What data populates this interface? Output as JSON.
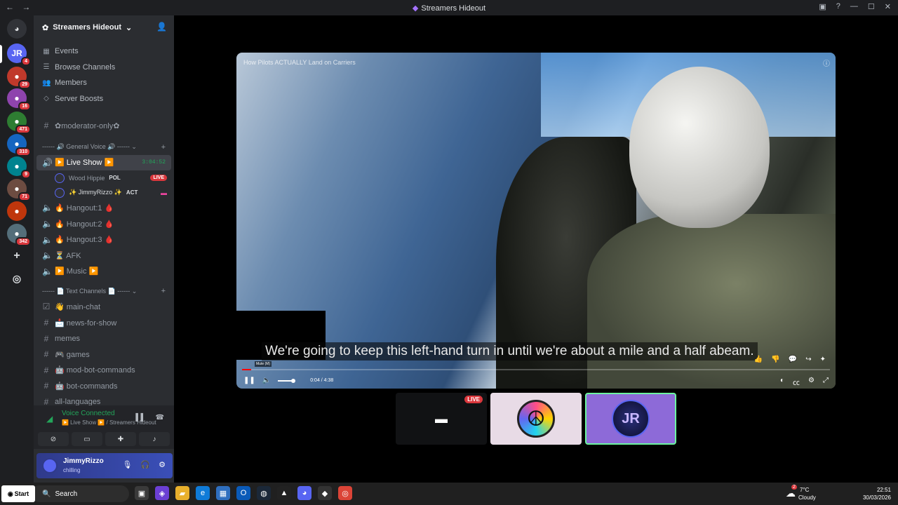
{
  "window": {
    "title": "Streamers Hideout"
  },
  "server": {
    "name": "Streamers Hideout"
  },
  "rail": {
    "badges": [
      "4",
      "29",
      "16",
      "471",
      "310",
      "9",
      "71",
      "342"
    ]
  },
  "menu": [
    {
      "label": "Events"
    },
    {
      "label": "Browse Channels"
    },
    {
      "label": "Members"
    },
    {
      "label": "Server Boosts"
    }
  ],
  "channels_top": [
    {
      "label": "✿moderator-only✿"
    }
  ],
  "voice_category": "------ 🔊 General Voice 🔊 ------",
  "voice_channels": [
    {
      "label": "▶️ Live Show ▶️",
      "timer": "3:04:52"
    },
    {
      "label": "🔥 Hangout:1 🩸"
    },
    {
      "label": "🔥 Hangout:2 🩸"
    },
    {
      "label": "🔥 Hangout:3 🩸"
    },
    {
      "label": "⏳ AFK"
    },
    {
      "label": "▶️ Music ▶️"
    }
  ],
  "voice_users": [
    {
      "name": "Wood Hippie",
      "tag": "POL",
      "status": "LIVE"
    },
    {
      "name": "✨ JimmyRizzo ✨",
      "tag": "ACT"
    }
  ],
  "text_category": "------ 📄 Text Channels 📄 ------",
  "text_channels": [
    {
      "label": "👋 main-chat"
    },
    {
      "label": "📩 news-for-show"
    },
    {
      "label": "memes"
    },
    {
      "label": "🎮 games"
    },
    {
      "label": "🤖 mod-bot-commands"
    },
    {
      "label": "🤖 bot-commands"
    },
    {
      "label": "all-languages"
    }
  ],
  "voice_panel": {
    "status": "Voice Connected",
    "location": "▶️ Live Show ▶️ / Streamers Hideout"
  },
  "user": {
    "name": "JimmyRizzo",
    "status": "chilling"
  },
  "video": {
    "title": "How Pilots ACTUALLY Land on Carriers",
    "caption": "We're going to keep this left-hand turn in until we're about a mile and a half abeam.",
    "time": "0:04 / 4:38",
    "mute_tip": "Mute (M)",
    "progress": 0.015
  },
  "tiles": {
    "stream_live": "LIVE",
    "jr_initials": "JR"
  },
  "taskbar": {
    "start": "Start",
    "search": "Search",
    "weather_temp": "7°C",
    "weather_desc": "Cloudy",
    "weather_badge": "2",
    "time": "22:51",
    "date": "30/03/2026"
  }
}
